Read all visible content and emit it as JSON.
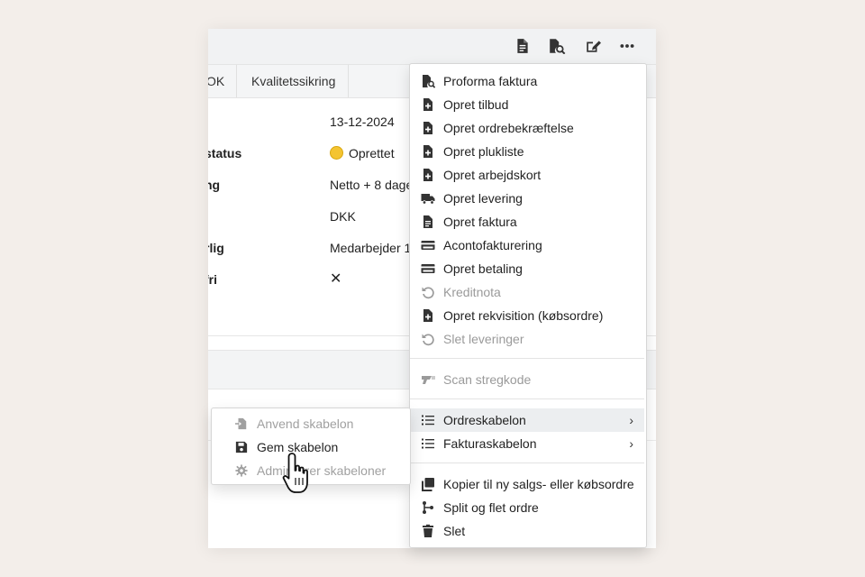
{
  "tabs": [
    {
      "label": "OK"
    },
    {
      "label": "Kvalitetssikring"
    }
  ],
  "details": [
    {
      "label": "",
      "value": "13-12-2024"
    },
    {
      "label": "status",
      "value": "Oprettet"
    },
    {
      "label": "ng",
      "value": "Netto + 8 dage"
    },
    {
      "label": "",
      "value": "DKK"
    },
    {
      "label": "rlig",
      "value": "Medarbejder 1"
    },
    {
      "label": "fri",
      "value": "✕"
    }
  ],
  "menu": {
    "items": [
      {
        "label": "Proforma faktura",
        "icon": "file-search-icon",
        "disabled": false
      },
      {
        "label": "Opret tilbud",
        "icon": "file-plus-icon",
        "disabled": false
      },
      {
        "label": "Opret ordrebekræftelse",
        "icon": "file-plus-icon",
        "disabled": false
      },
      {
        "label": "Opret plukliste",
        "icon": "file-plus-icon",
        "disabled": false
      },
      {
        "label": "Opret arbejdskort",
        "icon": "file-plus-icon",
        "disabled": false
      },
      {
        "label": "Opret levering",
        "icon": "truck-icon",
        "disabled": false
      },
      {
        "label": "Opret faktura",
        "icon": "file-text-icon",
        "disabled": false
      },
      {
        "label": "Acontofakturering",
        "icon": "credit-card-icon",
        "disabled": false
      },
      {
        "label": "Opret betaling",
        "icon": "credit-card-icon",
        "disabled": false
      },
      {
        "label": "Kreditnota",
        "icon": "undo-icon",
        "disabled": true
      },
      {
        "label": "Opret rekvisition (købsordre)",
        "icon": "file-plus-icon",
        "disabled": false
      },
      {
        "label": "Slet leveringer",
        "icon": "undo-icon",
        "disabled": true
      }
    ],
    "scan": {
      "label": "Scan stregkode",
      "icon": "barcode-scanner-icon",
      "disabled": true
    },
    "templates": [
      {
        "label": "Ordreskabelon",
        "icon": "list-icon",
        "highlighted": true
      },
      {
        "label": "Fakturaskabelon",
        "icon": "list-icon",
        "highlighted": false
      }
    ],
    "actions": [
      {
        "label": "Kopier til ny salgs- eller købsordre",
        "icon": "copy-icon"
      },
      {
        "label": "Split og flet ordre",
        "icon": "split-icon"
      },
      {
        "label": "Slet",
        "icon": "trash-icon"
      }
    ]
  },
  "submenu": {
    "items": [
      {
        "label": "Anvend skabelon",
        "icon": "file-import-icon",
        "disabled": true
      },
      {
        "label": "Gem skabelon",
        "icon": "save-icon",
        "disabled": false
      },
      {
        "label": "Administrer skabeloner",
        "icon": "gear-icon",
        "disabled": true
      }
    ]
  },
  "colors": {
    "background": "#f3eeea",
    "status_dot": "#f4c431",
    "false_mark": "#d33d3d",
    "highlight": "#eceef0",
    "disabled_text": "#9a9a9a"
  }
}
